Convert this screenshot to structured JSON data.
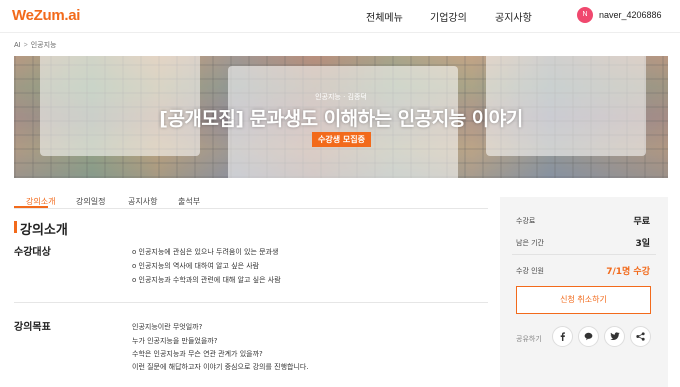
{
  "header": {
    "logo": "WeZum.ai",
    "nav": [
      "전체메뉴",
      "기업강의",
      "공지사항"
    ],
    "avatar_initial": "N",
    "username": "naver_4206886"
  },
  "breadcrumb": [
    "AI",
    "인공지능"
  ],
  "hero": {
    "subtitle": "인공지능 · 김종덕",
    "title": "[공개모집] 문과생도 이해하는 인공지능 이야기",
    "badge": "수강생 모집중"
  },
  "tabs": [
    "강의소개",
    "강의일정",
    "공지사항",
    "출석부"
  ],
  "section_title": "강의소개",
  "target": {
    "label": "수강대상",
    "lines": [
      "o 인공지능에 관심은 있으나 두려움이 있는 문과생",
      "o 인공지능의 역사에 대하여 알고 싶은 사람",
      "o 인공지능과 수학과의 관련에 대해 알고 싶은 사람"
    ]
  },
  "goal": {
    "label": "강의목표",
    "lines": [
      "인공지능이란 무엇일까?",
      "누가 인공지능을 만들었을까?",
      "수학은 인공지능과 무슨 연관 관계가 있을까?",
      "이런 질문에 해답하고자 이야기 중심으로 강의를 진행합니다."
    ]
  },
  "panel": {
    "fee_label": "수강료",
    "fee_value": "무료",
    "period_label": "남은 기간",
    "period_value": "3일",
    "students_label": "수강 인원",
    "students_value": "7/1명 수강",
    "cancel_button": "신청 취소하기",
    "share_label": "공유하기",
    "share_icons": [
      "facebook-icon",
      "speech-bubble-icon",
      "twitter-icon",
      "share-icon"
    ]
  },
  "colors": {
    "accent": "#f26a1b",
    "avatar": "#f0486e"
  }
}
